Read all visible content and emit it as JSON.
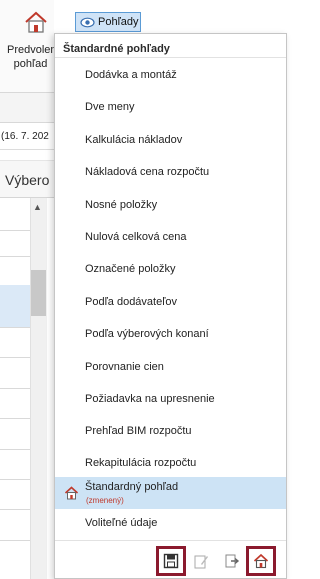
{
  "ribbon": {
    "predvolene_label_line1": "Predvolen",
    "predvolene_label_line2": "pohľad",
    "pohlady_label": "Pohľady"
  },
  "background": {
    "date_text": "(16. 7. 202",
    "grid_header": "Výbero"
  },
  "dropdown": {
    "section_title": "Štandardné pohľady",
    "items": [
      {
        "label": "Dodávka a montáž"
      },
      {
        "label": "Dve meny"
      },
      {
        "label": "Kalkulácia nákladov"
      },
      {
        "label": "Nákladová cena rozpočtu"
      },
      {
        "label": "Nosné položky"
      },
      {
        "label": "Nulová celková cena"
      },
      {
        "label": "Označené položky"
      },
      {
        "label": "Podľa dodávateľov"
      },
      {
        "label": "Podľa výberových konaní"
      },
      {
        "label": "Porovnanie cien"
      },
      {
        "label": "Požiadavka na upresnenie"
      },
      {
        "label": "Prehľad BIM rozpočtu"
      },
      {
        "label": "Rekapitulácia rozpočtu"
      },
      {
        "label": "Štandardný pohľad",
        "sublabel": "(zmenený)",
        "active": true
      },
      {
        "label": "Voliteľné údaje"
      }
    ],
    "toolbar": {
      "icons": [
        "save-icon",
        "edit-icon",
        "export-icon",
        "home-icon"
      ]
    }
  },
  "colors": {
    "accent": "#5b9bd5",
    "selected_bg": "#cde3f5",
    "highlight_border": "#8b1a2e",
    "changed_text": "#c0392b",
    "home_icon": "#c0392b"
  }
}
